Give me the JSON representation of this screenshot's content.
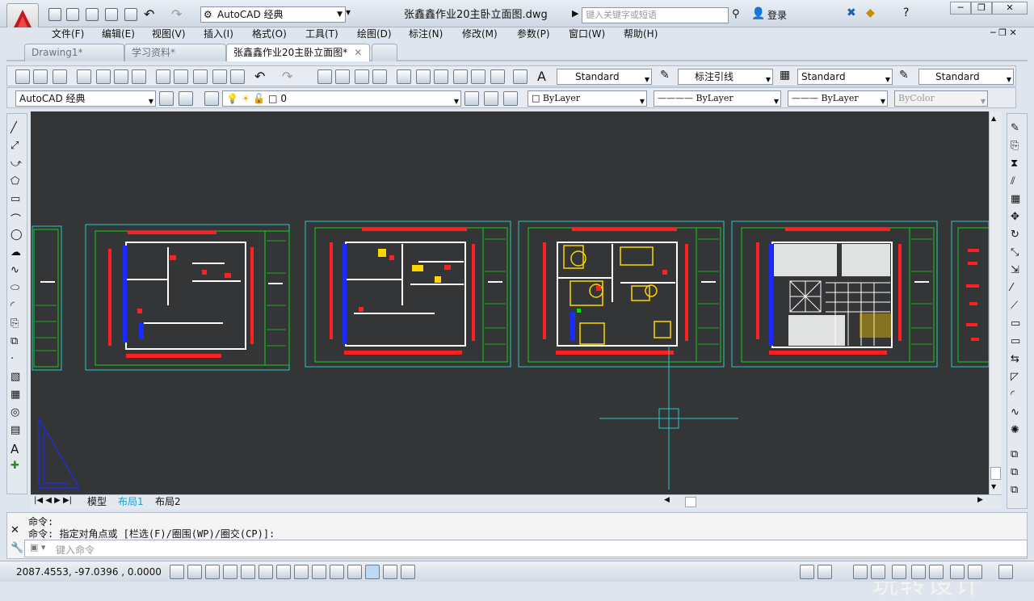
{
  "app": {
    "workspace": "AutoCAD 经典",
    "document_title": "张鑫鑫作业20主卧立面图.dwg",
    "search_placeholder": "键入关键字或短语",
    "login": "登录"
  },
  "menu": [
    "文件(F)",
    "编辑(E)",
    "视图(V)",
    "插入(I)",
    "格式(O)",
    "工具(T)",
    "绘图(D)",
    "标注(N)",
    "修改(M)",
    "参数(P)",
    "窗口(W)",
    "帮助(H)"
  ],
  "tabs": [
    {
      "label": "Drawing1*",
      "active": false
    },
    {
      "label": "学习资料*",
      "active": false
    },
    {
      "label": "张鑫鑫作业20主卧立面图*",
      "active": true
    }
  ],
  "styles_toolbar": {
    "text_style": "Standard",
    "mleader_style": "标注引线",
    "table_style": "Standard",
    "dim_style": "Standard"
  },
  "layers_toolbar": {
    "workspace": "AutoCAD 经典",
    "layer": "0",
    "color": "ByLayer",
    "linetype": "ByLayer",
    "lineweight": "ByLayer",
    "plotstyle": "ByColor"
  },
  "layout_tabs": [
    "模型",
    "布局1",
    "布局2"
  ],
  "command": {
    "line1": "命令:",
    "line2": "命令: 指定对角点或 [栏选(F)/圈围(WP)/圈交(CP)]:",
    "input_placeholder": "键入命令"
  },
  "status": {
    "coords": "2087.4553, -97.0396 , 0.0000"
  },
  "watermark": "玩转设计",
  "colors": {
    "canvas": "#333537",
    "frame": "#28c8c8",
    "border": "#18d018",
    "wall": "#ffffff",
    "dim": "#ff2020",
    "door": "#1a2bff",
    "furniture": "#ffd500"
  }
}
